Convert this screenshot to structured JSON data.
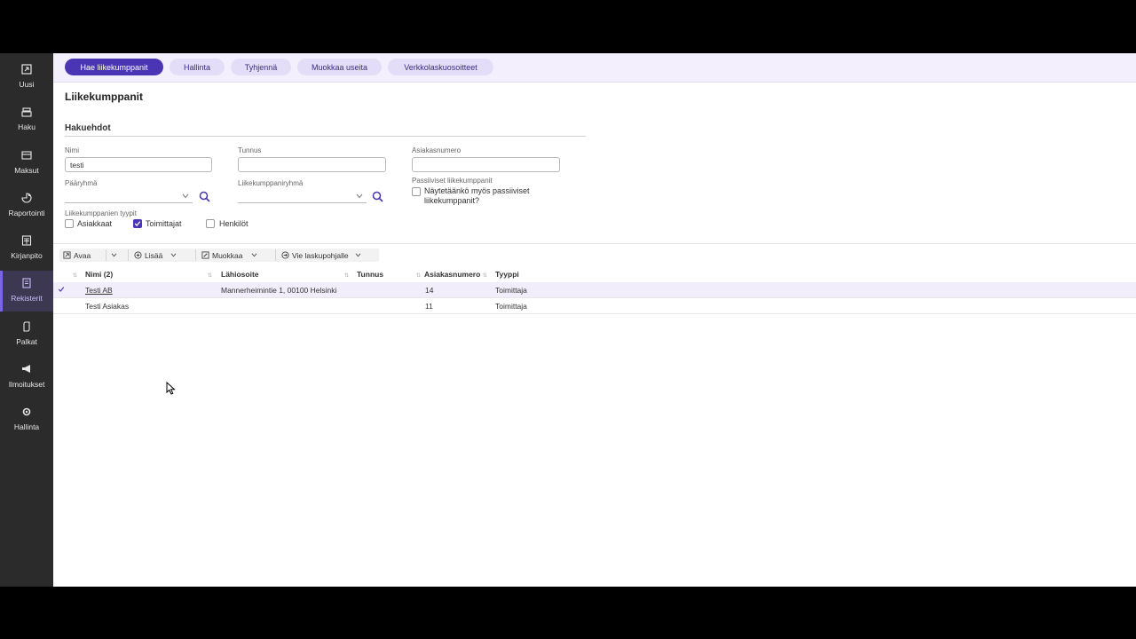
{
  "sidebar": {
    "items": [
      {
        "label": "Uusi",
        "icon": "new-document-icon"
      },
      {
        "label": "Haku",
        "icon": "search-stack-icon"
      },
      {
        "label": "Maksut",
        "icon": "payments-icon"
      },
      {
        "label": "Raportointi",
        "icon": "report-chart-icon"
      },
      {
        "label": "Kirjanpito",
        "icon": "calculator-icon"
      },
      {
        "label": "Rekisterit",
        "icon": "register-list-icon"
      },
      {
        "label": "Palkat",
        "icon": "salary-icon"
      },
      {
        "label": "Ilmoitukset",
        "icon": "megaphone-icon"
      },
      {
        "label": "Hallinta",
        "icon": "gear-icon"
      }
    ]
  },
  "topbar": {
    "buttons": [
      "Hae liikekumppanit",
      "Hallinta",
      "Tyhjennä",
      "Muokkaa useita",
      "Verkkolaskuosoitteet"
    ]
  },
  "page": {
    "title": "Liikekumppanit",
    "section": "Hakuehdot"
  },
  "form": {
    "nimi_label": "Nimi",
    "nimi_value": "testi",
    "tunnus_label": "Tunnus",
    "tunnus_value": "",
    "asiakasnumero_label": "Asiakasnumero",
    "asiakasnumero_value": "",
    "paaryhma_label": "Pääryhmä",
    "ryhma_label": "Liikekumppaniryhmä",
    "passiiviset_label": "Passiiviset liikekumppanit",
    "passiiviset_check_label": "Näytetäänkö myös passiiviset liikekumppanit?",
    "tyypit_label": "Liikekumppanien tyypit",
    "tyypit": [
      {
        "label": "Asiakkaat",
        "checked": false
      },
      {
        "label": "Toimittajat",
        "checked": true
      },
      {
        "label": "Henkilöt",
        "checked": false
      }
    ]
  },
  "toolbar": {
    "avaa": "Avaa",
    "lisaa": "Lisää",
    "muokkaa": "Muokkaa",
    "vie": "Vie laskupohjalle"
  },
  "table": {
    "columns": [
      "Nimi (2)",
      "Lähiosoite",
      "Tunnus",
      "Asiakasnumero",
      "Tyyppi"
    ],
    "rows": [
      {
        "nimi": "Testi AB",
        "lahiosoite": "Mannerheimintie 1, 00100 Helsinki",
        "tunnus": "",
        "asiakasnumero": "14",
        "tyyppi": "Toimittaja",
        "selected": true
      },
      {
        "nimi": "Testi Asiakas",
        "lahiosoite": "",
        "tunnus": "",
        "asiakasnumero": "11",
        "tyyppi": "Toimittaja",
        "selected": false
      }
    ]
  },
  "colors": {
    "accent": "#4a35b5",
    "sidebar_bg": "#2b2b2b",
    "topbar_bg": "#f3effc"
  }
}
